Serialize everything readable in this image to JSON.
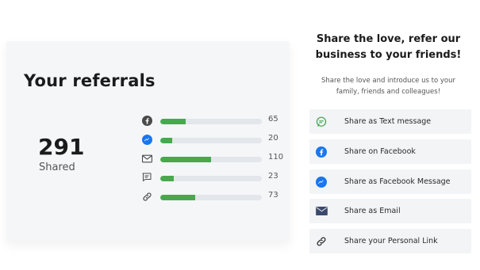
{
  "referrals": {
    "title": "Your referrals",
    "shared_count": "291",
    "shared_label": "Shared",
    "stats": [
      {
        "icon": "facebook-icon",
        "value": "65",
        "fill": 0.25
      },
      {
        "icon": "messenger-icon",
        "value": "20",
        "fill": 0.12
      },
      {
        "icon": "email-icon",
        "value": "110",
        "fill": 0.5
      },
      {
        "icon": "text-message-icon",
        "value": "23",
        "fill": 0.13
      },
      {
        "icon": "link-icon",
        "value": "73",
        "fill": 0.34
      }
    ]
  },
  "share": {
    "heading_line1": "Share the love, refer our",
    "heading_line2": "business to your friends!",
    "sub_line1": "Share the love and introduce us to your",
    "sub_line2": "family, friends and colleagues!",
    "buttons": [
      {
        "label": "Share as Text message",
        "icon": "text-message-icon"
      },
      {
        "label": "Share on Facebook",
        "icon": "facebook-icon"
      },
      {
        "label": "Share as Facebook Message",
        "icon": "messenger-icon"
      },
      {
        "label": "Share as Email",
        "icon": "email-icon"
      },
      {
        "label": "Share your Personal Link",
        "icon": "link-icon"
      }
    ]
  },
  "colors": {
    "bar_fill": "#48a84e",
    "bar_track": "#e3e6ea",
    "facebook_blue": "#1877f2",
    "sms_green": "#3aa04a",
    "email_navy": "#3b4a6b"
  }
}
